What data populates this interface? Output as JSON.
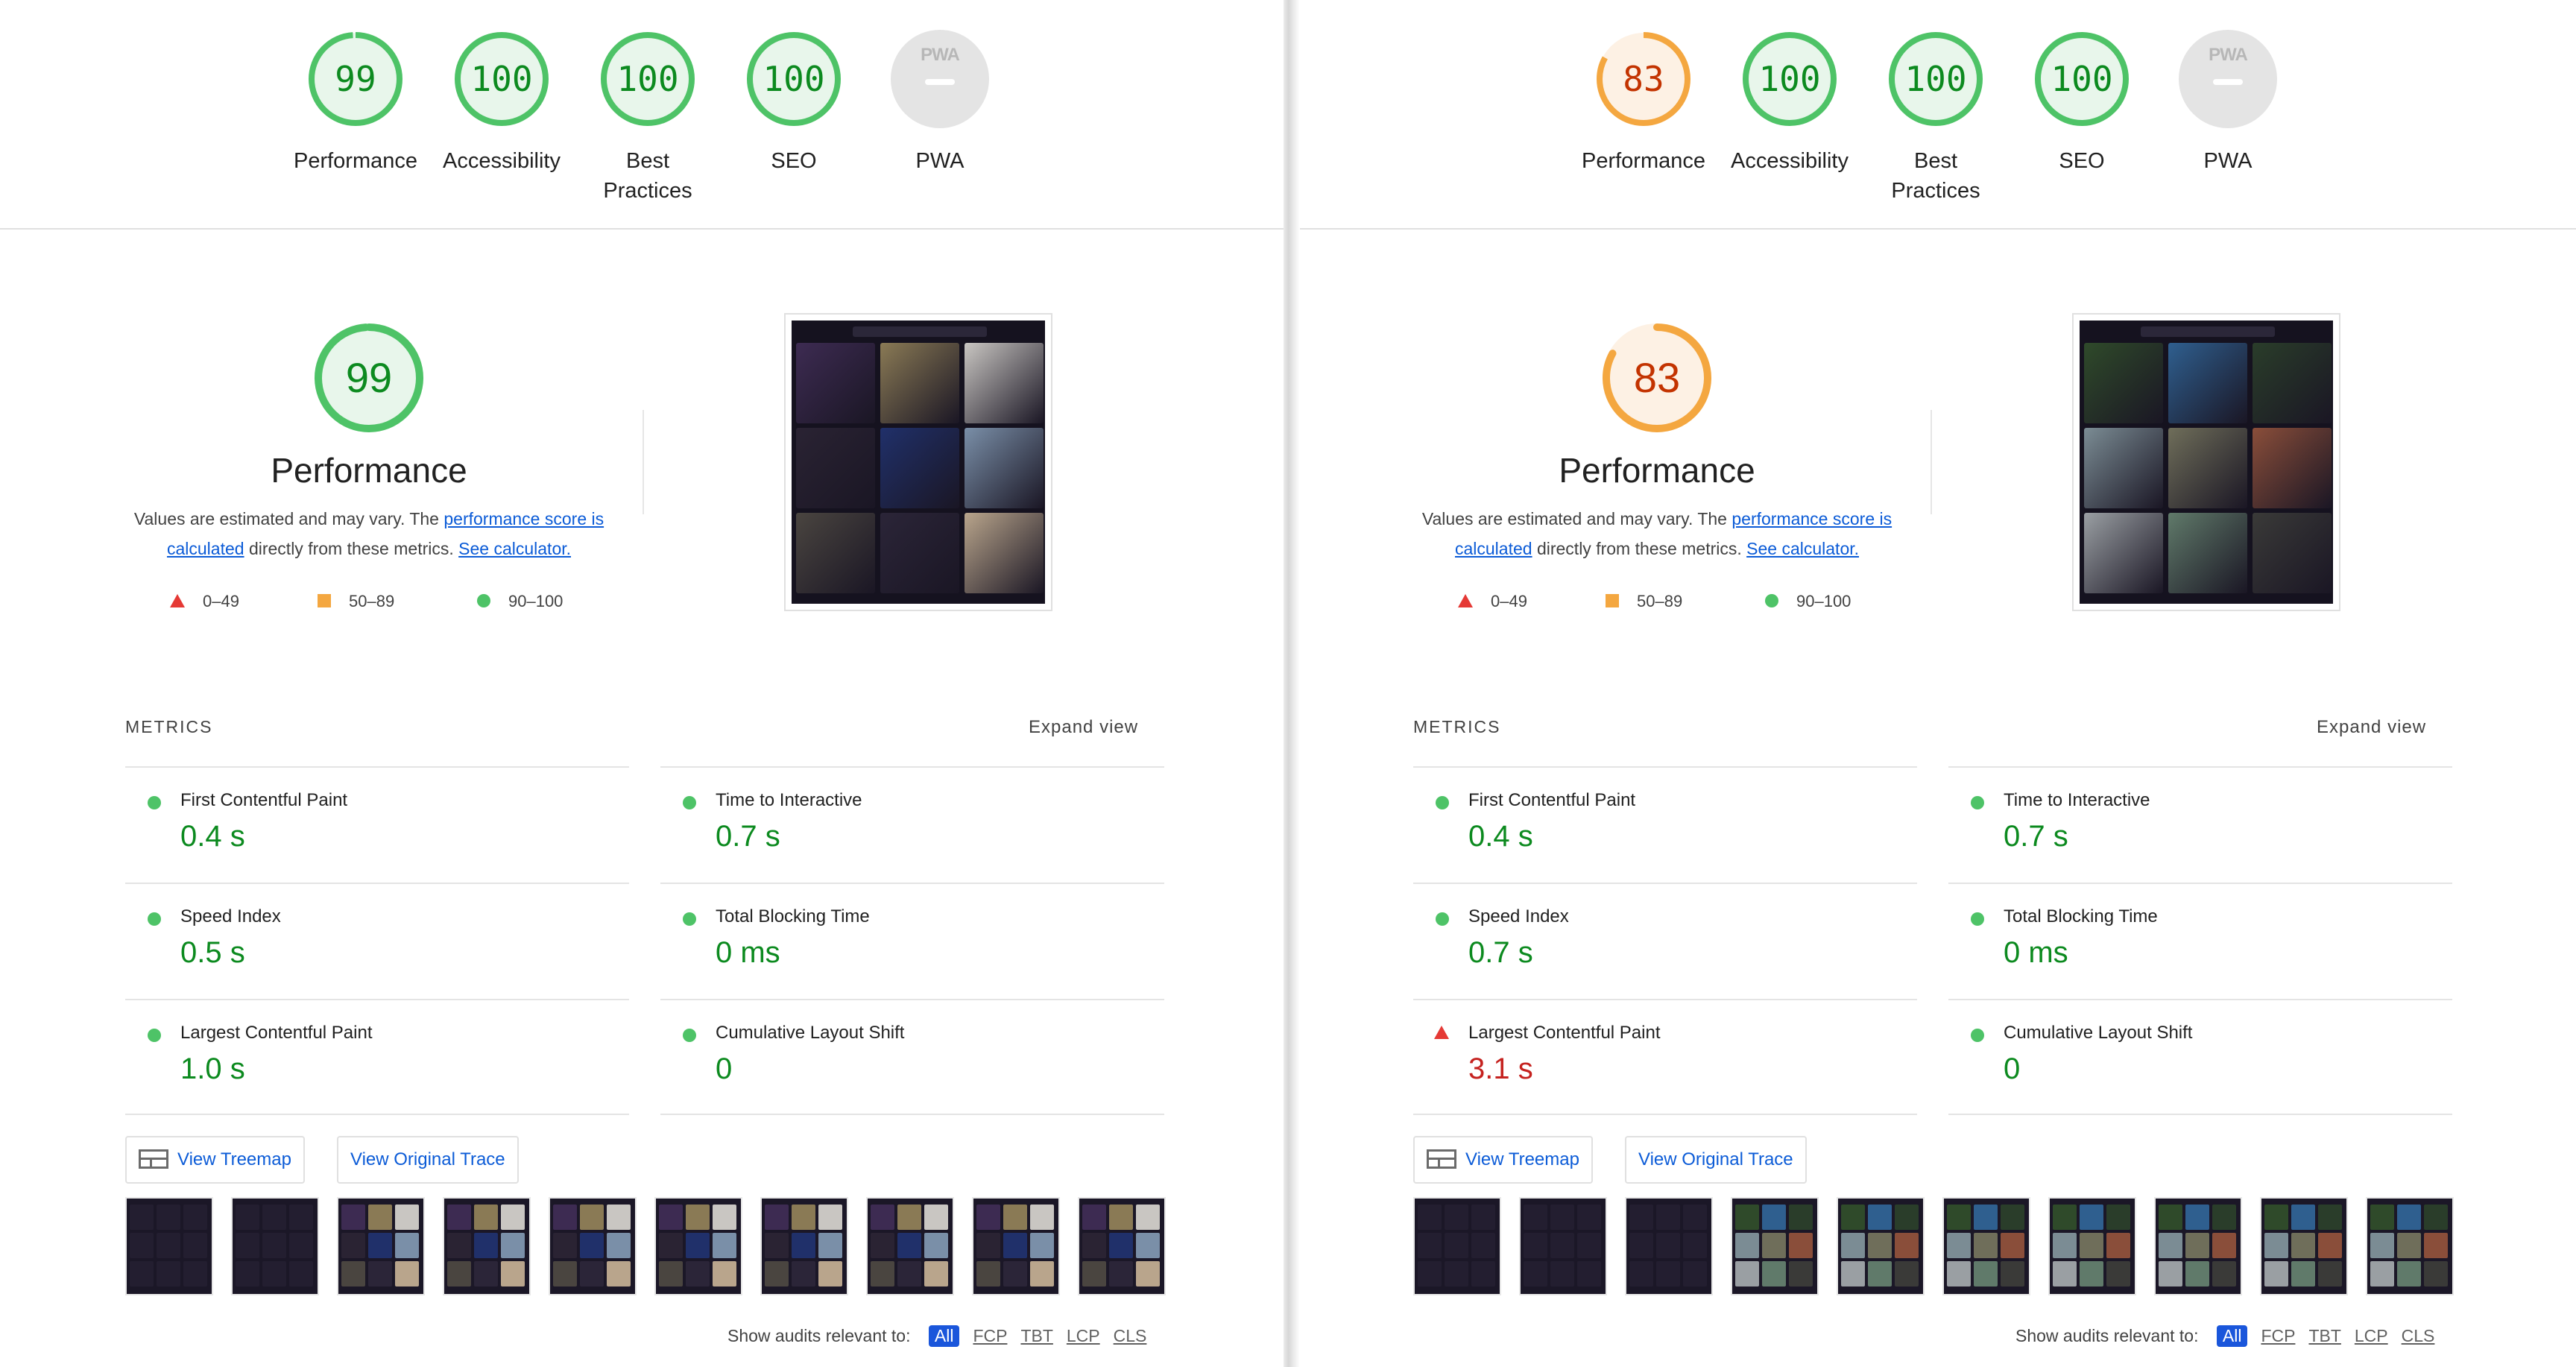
{
  "left": {
    "top_gauges": [
      {
        "score": "99",
        "label": "Performance",
        "level": "pass",
        "fill": 0.99
      },
      {
        "score": "100",
        "label": "Accessibility",
        "level": "pass",
        "fill": 1.0
      },
      {
        "score": "100",
        "label": "Best Practices",
        "level": "pass",
        "fill": 1.0
      },
      {
        "score": "100",
        "label": "SEO",
        "level": "pass",
        "fill": 1.0
      },
      {
        "score": "",
        "label": "PWA",
        "level": "na",
        "badge": "PWA"
      }
    ],
    "performance": {
      "score": "99",
      "fill": 0.99,
      "level": "pass",
      "title": "Performance",
      "desc_prefix": "Values are estimated and may vary. The ",
      "desc_link1": "performance score is calculated",
      "desc_middle": " directly from these metrics. ",
      "desc_link2": "See calculator."
    },
    "legend": {
      "fail": "0–49",
      "average": "50–89",
      "pass": "90–100"
    },
    "metrics_header": "METRICS",
    "expand_label": "Expand view",
    "metrics": [
      {
        "name": "First Contentful Paint",
        "value": "0.4 s",
        "level": "pass"
      },
      {
        "name": "Time to Interactive",
        "value": "0.7 s",
        "level": "pass"
      },
      {
        "name": "Speed Index",
        "value": "0.5 s",
        "level": "pass"
      },
      {
        "name": "Total Blocking Time",
        "value": "0 ms",
        "level": "pass"
      },
      {
        "name": "Largest Contentful Paint",
        "value": "1.0 s",
        "level": "pass"
      },
      {
        "name": "Cumulative Layout Shift",
        "value": "0",
        "level": "pass"
      }
    ],
    "treemap_label": "View Treemap",
    "trace_label": "View Original Trace",
    "audits_label": "Show audits relevant to:",
    "audit_filters": [
      "All",
      "FCP",
      "TBT",
      "LCP",
      "CLS"
    ]
  },
  "right": {
    "top_gauges": [
      {
        "score": "83",
        "label": "Performance",
        "level": "average",
        "fill": 0.83
      },
      {
        "score": "100",
        "label": "Accessibility",
        "level": "pass",
        "fill": 1.0
      },
      {
        "score": "100",
        "label": "Best Practices",
        "level": "pass",
        "fill": 1.0
      },
      {
        "score": "100",
        "label": "SEO",
        "level": "pass",
        "fill": 1.0
      },
      {
        "score": "",
        "label": "PWA",
        "level": "na",
        "badge": "PWA"
      }
    ],
    "performance": {
      "score": "83",
      "fill": 0.83,
      "level": "average",
      "title": "Performance",
      "desc_prefix": "Values are estimated and may vary. The ",
      "desc_link1": "performance score is calculated",
      "desc_middle": " directly from these metrics. ",
      "desc_link2": "See calculator."
    },
    "legend": {
      "fail": "0–49",
      "average": "50–89",
      "pass": "90–100"
    },
    "metrics_header": "METRICS",
    "expand_label": "Expand view",
    "metrics": [
      {
        "name": "First Contentful Paint",
        "value": "0.4 s",
        "level": "pass"
      },
      {
        "name": "Time to Interactive",
        "value": "0.7 s",
        "level": "pass"
      },
      {
        "name": "Speed Index",
        "value": "0.7 s",
        "level": "pass"
      },
      {
        "name": "Total Blocking Time",
        "value": "0 ms",
        "level": "pass"
      },
      {
        "name": "Largest Contentful Paint",
        "value": "3.1 s",
        "level": "fail"
      },
      {
        "name": "Cumulative Layout Shift",
        "value": "0",
        "level": "pass"
      }
    ],
    "treemap_label": "View Treemap",
    "trace_label": "View Original Trace",
    "audits_label": "Show audits relevant to:",
    "audit_filters": [
      "All",
      "FCP",
      "TBT",
      "LCP",
      "CLS"
    ]
  },
  "colors": {
    "pass": "#0c8a1f",
    "pass_ring": "#4ec367",
    "pass_bg": "#e8f6eb",
    "average": "#c33300",
    "average_ring": "#f4a740",
    "average_bg": "#fdf1e4",
    "fail": "#c5221f",
    "link": "#0b5bd7"
  },
  "icons": {
    "fail": "triangle-icon",
    "average": "square-icon",
    "pass": "circle-icon",
    "treemap": "treemap-icon"
  }
}
